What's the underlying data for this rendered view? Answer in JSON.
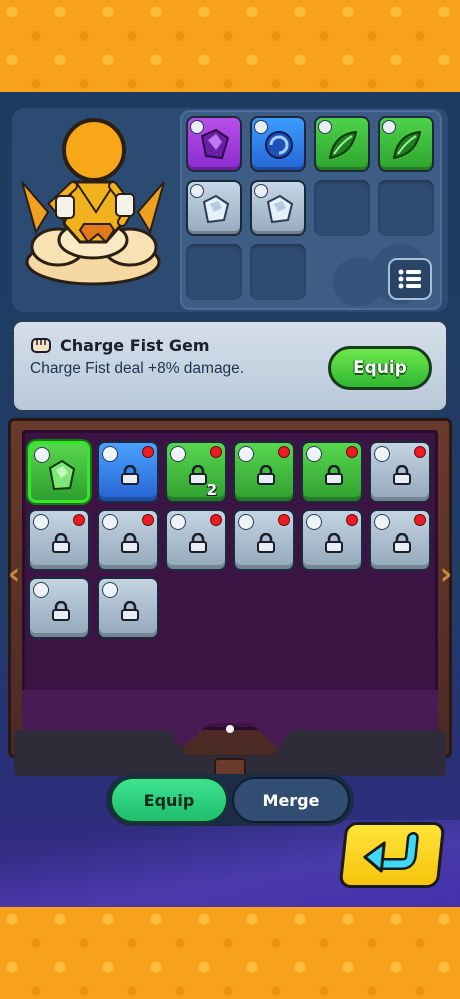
{
  "info": {
    "title": "Charge Fist Gem",
    "description": "Charge Fist deal +8% damage.",
    "equip_label": "Equip"
  },
  "inventory": {
    "selected_count": "2",
    "page_indicator": "1"
  },
  "tabs": {
    "equip_label": "Equip",
    "merge_label": "Merge"
  },
  "colors": {
    "accent_green": "#2fb734",
    "notification_red": "#ee1b23",
    "background": "#1f3a5e",
    "frame_orange": "#f7a21a"
  }
}
